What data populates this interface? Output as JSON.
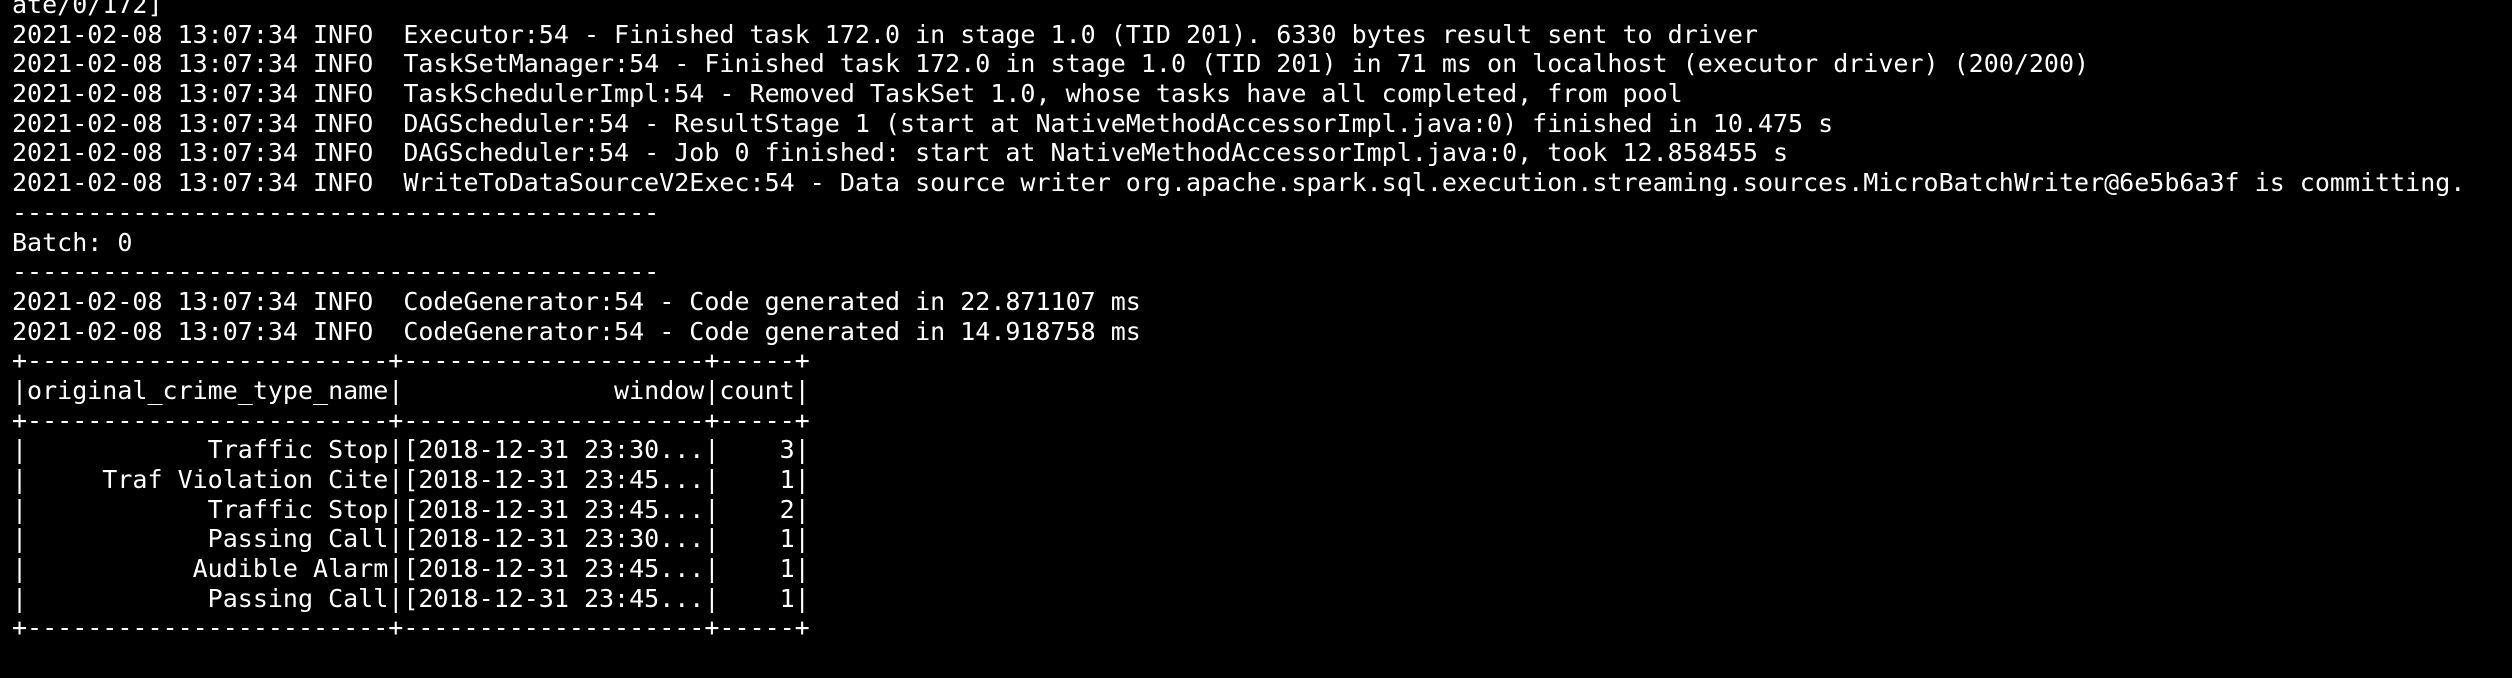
{
  "terminal": {
    "lines": [
      "ate/0/172]",
      "2021-02-08 13:07:34 INFO  Executor:54 - Finished task 172.0 in stage 1.0 (TID 201). 6330 bytes result sent to driver",
      "2021-02-08 13:07:34 INFO  TaskSetManager:54 - Finished task 172.0 in stage 1.0 (TID 201) in 71 ms on localhost (executor driver) (200/200)",
      "2021-02-08 13:07:34 INFO  TaskSchedulerImpl:54 - Removed TaskSet 1.0, whose tasks have all completed, from pool",
      "2021-02-08 13:07:34 INFO  DAGScheduler:54 - ResultStage 1 (start at NativeMethodAccessorImpl.java:0) finished in 10.475 s",
      "2021-02-08 13:07:34 INFO  DAGScheduler:54 - Job 0 finished: start at NativeMethodAccessorImpl.java:0, took 12.858455 s",
      "2021-02-08 13:07:34 INFO  WriteToDataSourceV2Exec:54 - Data source writer org.apache.spark.sql.execution.streaming.sources.MicroBatchWriter@6e5b6a3f is committing.",
      "-------------------------------------------",
      "Batch: 0",
      "-------------------------------------------",
      "2021-02-08 13:07:34 INFO  CodeGenerator:54 - Code generated in 22.871107 ms",
      "2021-02-08 13:07:34 INFO  CodeGenerator:54 - Code generated in 14.918758 ms",
      "+------------------------+--------------------+-----+",
      "|original_crime_type_name|              window|count|",
      "+------------------------+--------------------+-----+",
      "|            Traffic Stop|[2018-12-31 23:30...|    3|",
      "|     Traf Violation Cite|[2018-12-31 23:45...|    1|",
      "|            Traffic Stop|[2018-12-31 23:45...|    2|",
      "|            Passing Call|[2018-12-31 23:30...|    1|",
      "|           Audible Alarm|[2018-12-31 23:45...|    1|",
      "|            Passing Call|[2018-12-31 23:45...|    1|",
      "+------------------------+--------------------+-----+"
    ]
  }
}
